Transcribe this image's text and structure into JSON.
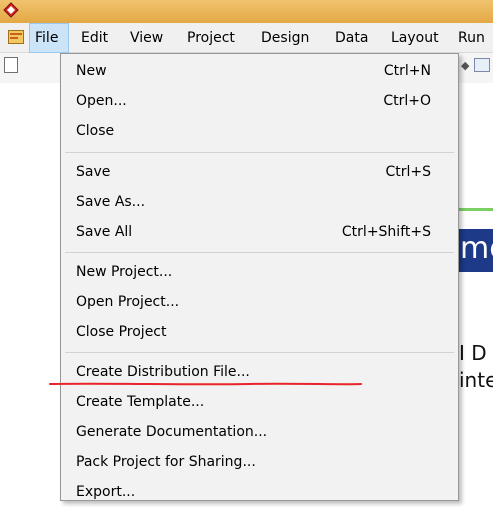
{
  "title_bar": {
    "app_icon": "red-diamond-app-icon",
    "accent_color": "#e3a845"
  },
  "menu_bar": {
    "items": [
      {
        "label": "File",
        "active": true
      },
      {
        "label": "Edit"
      },
      {
        "label": "View"
      },
      {
        "label": "Project"
      },
      {
        "label": "Design"
      },
      {
        "label": "Data"
      },
      {
        "label": "Layout"
      },
      {
        "label": "Run"
      }
    ]
  },
  "background": {
    "banner_text": "me",
    "text_lines": [
      "I D",
      "inte"
    ]
  },
  "file_menu": {
    "groups": [
      [
        {
          "label": "New",
          "shortcut": "Ctrl+N"
        },
        {
          "label": "Open...",
          "shortcut": "Ctrl+O"
        },
        {
          "label": "Close",
          "shortcut": ""
        }
      ],
      [
        {
          "label": "Save",
          "shortcut": "Ctrl+S"
        },
        {
          "label": "Save As...",
          "shortcut": ""
        },
        {
          "label": "Save All",
          "shortcut": "Ctrl+Shift+S"
        }
      ],
      [
        {
          "label": "New Project...",
          "shortcut": ""
        },
        {
          "label": "Open Project...",
          "shortcut": ""
        },
        {
          "label": "Close Project",
          "shortcut": ""
        }
      ],
      [
        {
          "label": "Create Distribution File...",
          "shortcut": "",
          "underlined_in_red": true
        },
        {
          "label": "Create Template...",
          "shortcut": ""
        },
        {
          "label": "Generate Documentation...",
          "shortcut": ""
        },
        {
          "label": "Pack Project for Sharing...",
          "shortcut": ""
        },
        {
          "label": "Export...",
          "shortcut": ""
        }
      ]
    ],
    "annotation_color": "#e8242a"
  }
}
